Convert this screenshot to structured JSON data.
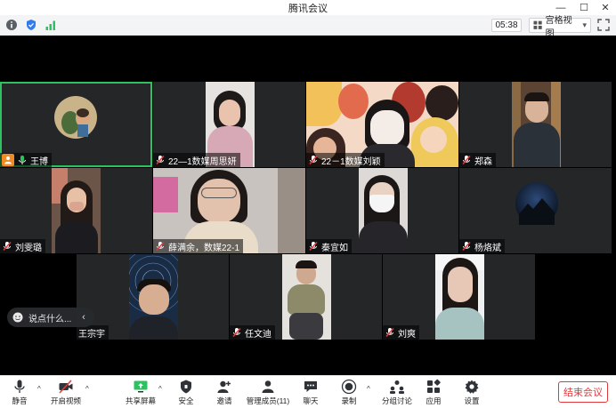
{
  "window": {
    "title": "腾讯会议",
    "minimize": "—",
    "maximize": "☐",
    "close": "✕"
  },
  "topbar": {
    "timer": "05:38",
    "view_label": "宫格视图",
    "view_caret": "▾"
  },
  "participants": [
    {
      "name": "王博",
      "active": true,
      "sharing": true,
      "mic": "on"
    },
    {
      "name": "22—1数媒周思妍",
      "mic": "off"
    },
    {
      "name": "22－1数媒刘颖",
      "mic": "off"
    },
    {
      "name": "郑森",
      "mic": "off"
    },
    {
      "name": "刘雯璐",
      "mic": "off"
    },
    {
      "name": "薛满余，数媒22-1",
      "mic": "off"
    },
    {
      "name": "秦宜如",
      "mic": "off"
    },
    {
      "name": "杨烙斌",
      "mic": "off"
    },
    {
      "name": "王宗宇",
      "mic": "none"
    },
    {
      "name": "任文迪",
      "mic": "off"
    },
    {
      "name": "刘爽",
      "mic": "off"
    }
  ],
  "chat": {
    "placeholder": "说点什么...",
    "collapse": "‹"
  },
  "toolbar": {
    "mute": "静音",
    "video": "开启视频",
    "share": "共享屏幕",
    "security": "安全",
    "invite": "邀请",
    "members": "管理成员(11)",
    "chat": "聊天",
    "record": "录制",
    "breakout": "分组讨论",
    "apps": "应用",
    "settings": "设置",
    "end": "结束会议",
    "caret": "^"
  },
  "colors": {
    "active_border": "#2bc25f",
    "end_red": "#e0393e",
    "share_orange": "#f08a24"
  }
}
